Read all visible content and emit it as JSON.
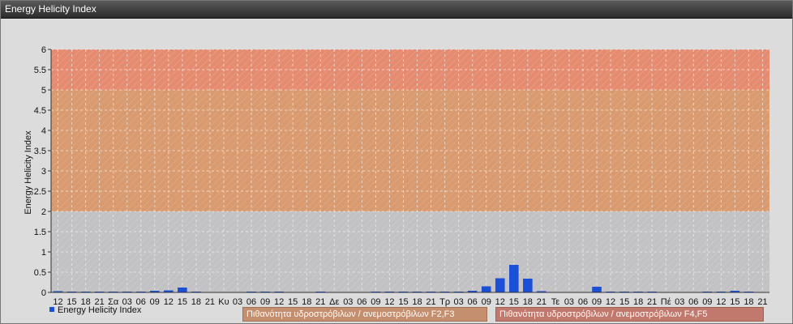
{
  "window": {
    "title": "Energy Helicity Index"
  },
  "colors": {
    "panel_bg": "#dcdcdc",
    "plot_bg": "#c2c2c4",
    "band_low": "#d89a6e",
    "band_mid": "#e7a867",
    "band_high": "#e58b70",
    "bar": "#1a4fd6",
    "grid": "#eeeeee"
  },
  "legend": {
    "series_label": "Energy Helicity Index",
    "band_f2f3": "Πιθανότητα υδροστρόβιλων / ανεμοστρόβιλων F2,F3",
    "band_f4f5": "Πιθανότητα υδροστρόβιλων / ανεμοστρόβιλων F4,F5"
  },
  "chart_data": {
    "type": "bar",
    "ylabel": "Energy Helicity Index",
    "ylim": [
      0,
      6
    ],
    "yticks": [
      "0",
      "0.5",
      "1",
      "1.5",
      "2",
      "2.5",
      "3",
      "3.5",
      "4",
      "4.5",
      "5",
      "5.5",
      "6"
    ],
    "grid": true,
    "legend_position": "bottom-left",
    "bands": [
      {
        "from": 2,
        "to": 5,
        "label": "Πιθανότητα υδροστρόβιλων / ανεμοστρόβιλων F2,F3"
      },
      {
        "from": 5,
        "to": 6,
        "label": "Πιθανότητα υδροστρόβιλων / ανεμοστρόβιλων F4,F5"
      }
    ],
    "categories": [
      "12",
      "15",
      "18",
      "21",
      "Σα",
      "03",
      "06",
      "09",
      "12",
      "15",
      "18",
      "21",
      "Κυ",
      "03",
      "06",
      "09",
      "12",
      "15",
      "18",
      "21",
      "Δε",
      "03",
      "06",
      "09",
      "12",
      "15",
      "18",
      "21",
      "Τρ",
      "03",
      "06",
      "09",
      "12",
      "15",
      "18",
      "21",
      "Τε",
      "03",
      "06",
      "09",
      "12",
      "15",
      "18",
      "21",
      "Πέ",
      "03",
      "06",
      "09",
      "12",
      "15",
      "18",
      "21"
    ],
    "series": [
      {
        "name": "Energy Helicity Index",
        "values": [
          0.03,
          0.02,
          0.02,
          0.02,
          0.02,
          0.02,
          0.02,
          0.04,
          0.05,
          0.12,
          0.02,
          0.01,
          0.01,
          0.01,
          0.02,
          0.02,
          0.02,
          0.01,
          0.01,
          0.02,
          0.01,
          0.01,
          0.01,
          0.02,
          0.02,
          0.02,
          0.02,
          0.02,
          0.02,
          0.02,
          0.04,
          0.15,
          0.35,
          0.68,
          0.34,
          0.03,
          0.01,
          0.01,
          0.01,
          0.14,
          0.02,
          0.02,
          0.02,
          0.02,
          0.01,
          0.01,
          0.01,
          0.02,
          0.02,
          0.04,
          0.02,
          0.01
        ]
      }
    ]
  }
}
